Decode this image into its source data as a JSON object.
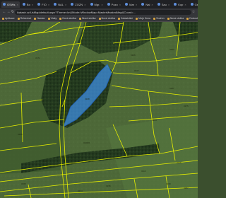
{
  "browser": {
    "tabs": [
      {
        "label": "GSWs"
      },
      {
        "label": "Bo"
      },
      {
        "label": "FIO"
      },
      {
        "label": "NAL"
      },
      {
        "label": "ZOZN"
      },
      {
        "label": "Mgr."
      },
      {
        "label": "Pozo"
      },
      {
        "label": "Mar"
      },
      {
        "label": "Nal"
      },
      {
        "label": "Sau"
      },
      {
        "label": "Kop"
      },
      {
        "label": "Geor"
      },
      {
        "label": "Pla"
      },
      {
        "label": "KN"
      }
    ],
    "url": "ikatastr.cz/UsMap/default.aspx?Theme=kn&Mode=WindowMap=MasterMaskedMap&Coord=...",
    "bookmarks": [
      {
        "label": "Aplikace"
      },
      {
        "label": "Reláciové"
      },
      {
        "label": "Nastav"
      },
      {
        "label": "Vlaky"
      },
      {
        "label": "Nová složka"
      },
      {
        "label": "Nová složka"
      },
      {
        "label": "Nová složka"
      },
      {
        "label": "Katastrální"
      },
      {
        "label": "Moje firma"
      },
      {
        "label": "Souhrn"
      },
      {
        "label": "Nová složka"
      },
      {
        "label": "Dokončeno"
      },
      {
        "label": "Reedukce a cesty"
      }
    ]
  },
  "map": {
    "parcel_line_color": "#e8f000",
    "selected_fill_color": "#3f8fe0",
    "selected_stroke_color": "#1f5fb8",
    "forest_color": "#233a1e",
    "field_color": "#4a6435",
    "parcel_numbers": [
      "318",
      "322",
      "3174",
      "3106",
      "3263",
      "3107",
      "3168",
      "3167",
      "3175",
      "3206",
      "3104",
      "3106/2",
      "3113",
      "3228",
      "3265",
      "3195",
      "3108",
      "3214",
      "3209",
      "3287"
    ]
  }
}
